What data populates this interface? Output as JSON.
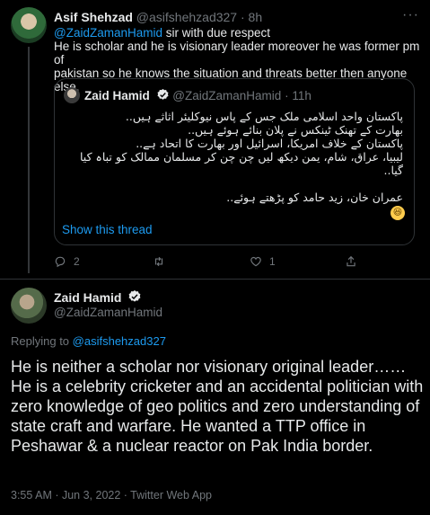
{
  "reply_tweet": {
    "name": "Asif Shehzad",
    "handle": "@asifshehzad327",
    "time": "8h",
    "mention": "@ZaidZamanHamid",
    "text_after_mention": " sir with due respect",
    "text_lines": [
      "He is scholar and he is visionary leader moreover he was former pm of",
      "pakistan so he knows the situation and threats better then anyone else."
    ],
    "quote": {
      "name": "Zaid Hamid",
      "handle": "@ZaidZamanHamid",
      "time": "11h",
      "lines": [
        "پاکستان واحد اسلامی ملک جس کے پاس نیوکلیئر اثاثے ہیں..",
        "بھارت کے تھنک ٹینکس نے پلان بنائے ہوئے ہیں..",
        "پاکستان کے خلاف امریکا، اسرائیل اور بھارت کا اتحاد ہے..",
        "لیبیا، عراق، شام، یمن دیکھ لیں چن چن کر مسلمان ممالک کو تباہ کیا گیا..",
        "",
        "عمران خان، زید حامد کو پڑھتے ہوئے.."
      ],
      "emoji": "grinning-squinting-face",
      "show_thread": "Show this thread"
    },
    "actions": {
      "reply_count": "2",
      "retweet_count": "",
      "like_count": "1"
    }
  },
  "main_tweet": {
    "name": "Zaid Hamid",
    "handle": "@ZaidZamanHamid",
    "replying_prefix": "Replying to ",
    "replying_to": "@asifshehzad327",
    "text": "He is neither a scholar nor visionary original leader…… He is a celebrity cricketer and an accidental politician with zero knowledge of geo politics and zero understanding of state craft and warfare. He wanted a TTP office in Peshawar & a nuclear reactor on Pak India border.",
    "timestamp": "3:55 AM · Jun 3, 2022 · Twitter Web App"
  },
  "colors": {
    "background": "#000000",
    "text": "#e7e9ea",
    "muted": "#71767b",
    "accent": "#1d9bf0",
    "border": "#2f3336"
  }
}
